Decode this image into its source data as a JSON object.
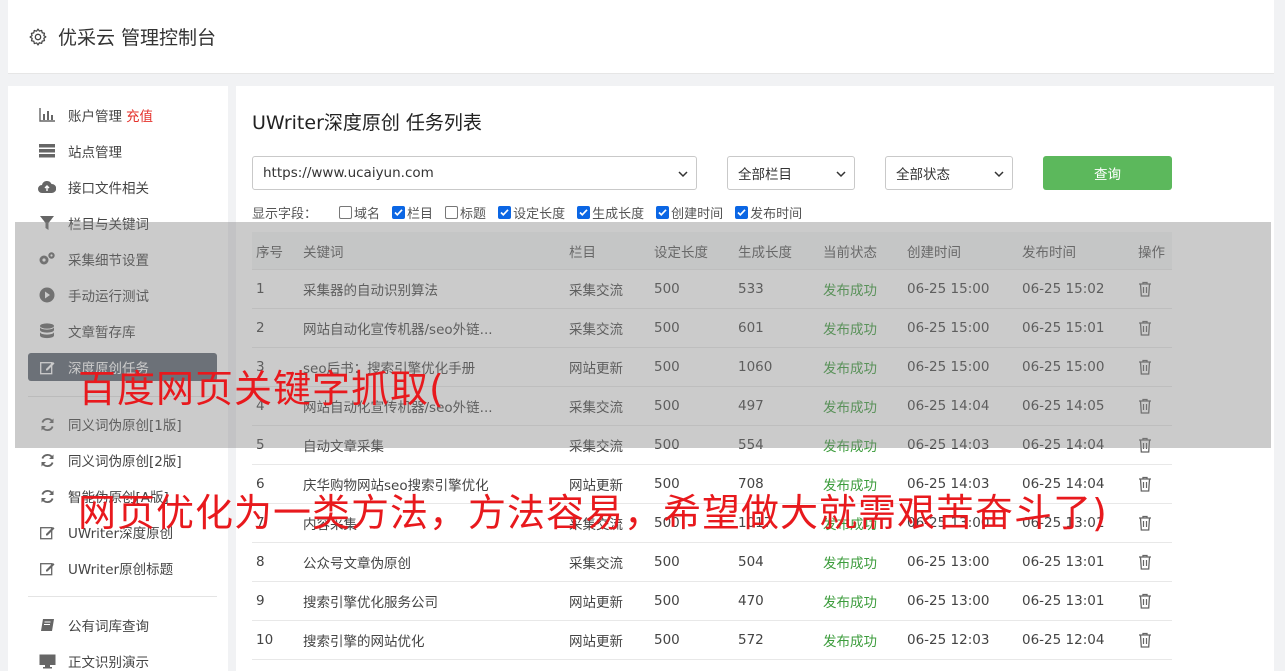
{
  "header": {
    "title": "优采云 管理控制台"
  },
  "sidebar": {
    "items": [
      {
        "label": "账户管理",
        "icon": "bar-chart-icon",
        "extra": "充值"
      },
      {
        "label": "站点管理",
        "icon": "server-icon"
      },
      {
        "label": "接口文件相关",
        "icon": "cloud-upload-icon"
      },
      {
        "label": "栏目与关键词",
        "icon": "filter-icon"
      },
      {
        "label": "采集细节设置",
        "icon": "gears-icon"
      },
      {
        "label": "手动运行测试",
        "icon": "play-circle-icon"
      },
      {
        "label": "文章暂存库",
        "icon": "database-icon"
      },
      {
        "label": "深度原创任务",
        "icon": "edit-icon",
        "active": true
      },
      {
        "label": "同义词伪原创[1版]",
        "icon": "refresh-icon"
      },
      {
        "label": "同义词伪原创[2版]",
        "icon": "refresh-icon"
      },
      {
        "label": "智能伪原创[A版]",
        "icon": "refresh-icon"
      },
      {
        "label": "UWriter深度原创",
        "icon": "edit-icon"
      },
      {
        "label": "UWriter原创标题",
        "icon": "edit-icon"
      },
      {
        "label": "公有词库查询",
        "icon": "book-icon"
      },
      {
        "label": "正文识别演示",
        "icon": "monitor-icon"
      }
    ]
  },
  "main": {
    "title": "UWriter深度原创 任务列表",
    "site_select": "https://www.ucaiyun.com",
    "column_select": "全部栏目",
    "status_select": "全部状态",
    "query_label": "查询",
    "fields_label": "显示字段：",
    "fields": [
      {
        "label": "域名",
        "checked": false
      },
      {
        "label": "栏目",
        "checked": true
      },
      {
        "label": "标题",
        "checked": false
      },
      {
        "label": "设定长度",
        "checked": true
      },
      {
        "label": "生成长度",
        "checked": true
      },
      {
        "label": "创建时间",
        "checked": true
      },
      {
        "label": "发布时间",
        "checked": true
      }
    ],
    "table": {
      "headers": [
        "序号",
        "关键词",
        "栏目",
        "设定长度",
        "生成长度",
        "当前状态",
        "创建时间",
        "发布时间",
        "操作"
      ],
      "rows": [
        [
          "1",
          "采集器的自动识别算法",
          "采集交流",
          "500",
          "533",
          "发布成功",
          "06-25 15:00",
          "06-25 15:02"
        ],
        [
          "2",
          "网站自动化宣传机器/seo外链...",
          "采集交流",
          "500",
          "601",
          "发布成功",
          "06-25 15:00",
          "06-25 15:01"
        ],
        [
          "3",
          "seo后书：搜索引擎优化手册",
          "网站更新",
          "500",
          "1060",
          "发布成功",
          "06-25 15:00",
          "06-25 15:00"
        ],
        [
          "4",
          "网站自动化宣传机器/seo外链...",
          "采集交流",
          "500",
          "497",
          "发布成功",
          "06-25 14:04",
          "06-25 14:05"
        ],
        [
          "5",
          "自动文章采集",
          "采集交流",
          "500",
          "554",
          "发布成功",
          "06-25 14:03",
          "06-25 14:04"
        ],
        [
          "6",
          "庆华购物网站seo搜索引擎优化",
          "网站更新",
          "500",
          "708",
          "发布成功",
          "06-25 14:03",
          "06-25 14:04"
        ],
        [
          "7",
          "内容采集",
          "采集交流",
          "500",
          "1017",
          "发布成功",
          "06-25 13:00",
          "06-25 13:01"
        ],
        [
          "8",
          "公众号文章伪原创",
          "采集交流",
          "500",
          "504",
          "发布成功",
          "06-25 13:00",
          "06-25 13:01"
        ],
        [
          "9",
          "搜索引擎优化服务公司",
          "网站更新",
          "500",
          "470",
          "发布成功",
          "06-25 13:00",
          "06-25 13:01"
        ],
        [
          "10",
          "搜索引擎的网站优化",
          "网站更新",
          "500",
          "572",
          "发布成功",
          "06-25 12:03",
          "06-25 12:04"
        ]
      ]
    }
  },
  "overlay": {
    "line1": "百度网页关键字抓取(",
    "line2": "网页优化为一类方法，方法容易，希望做大就需艰苦奋斗了)"
  }
}
